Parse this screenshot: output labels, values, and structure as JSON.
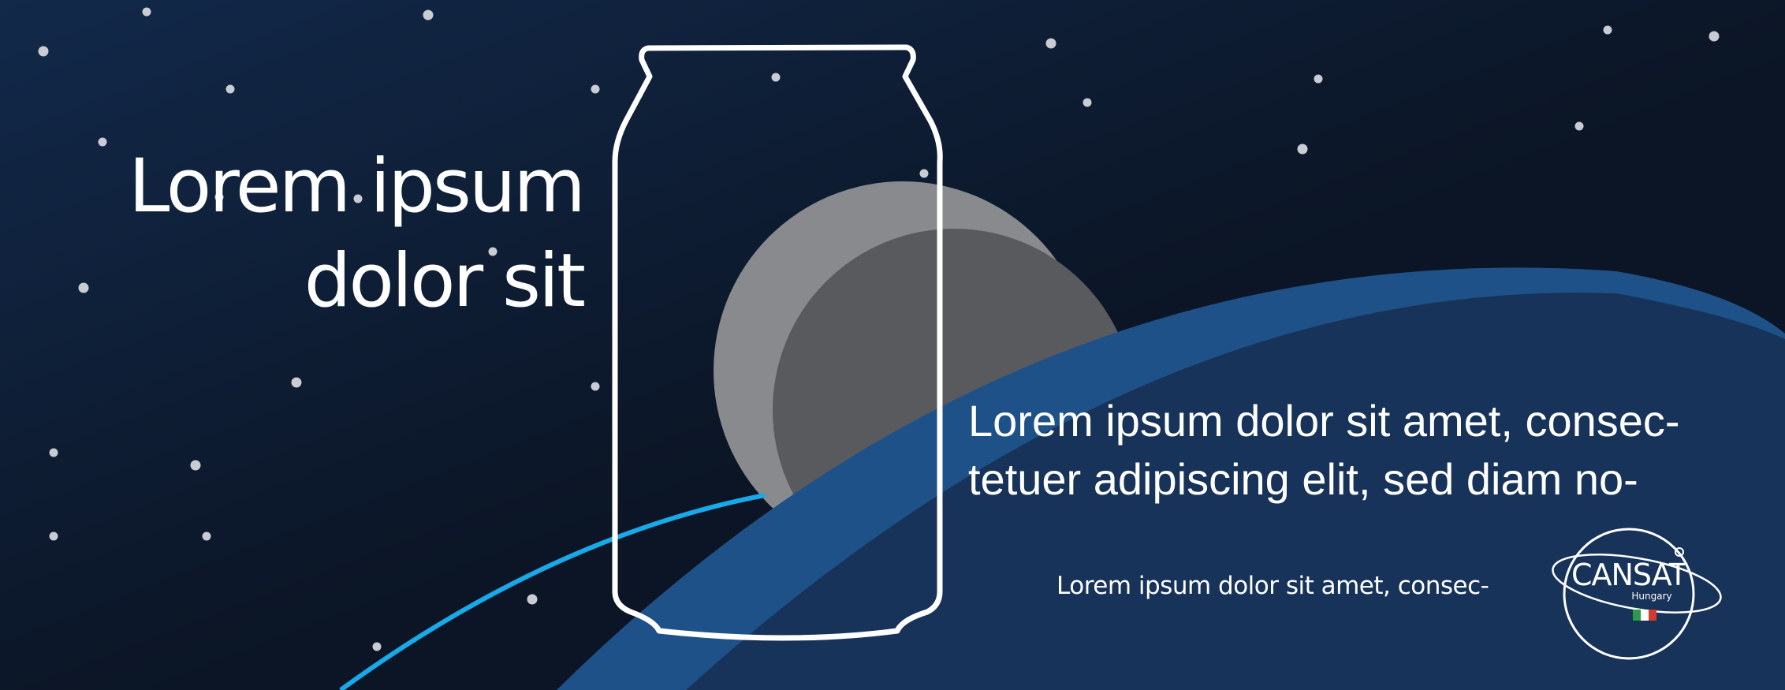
{
  "headline": {
    "line1": "Lorem ipsum",
    "line2": "dolor sit"
  },
  "body": {
    "line1": "Lorem ipsum dolor sit amet, consec-",
    "line2": "tetuer adipiscing elit, sed diam no-"
  },
  "tagline": "Lorem ipsum dolor sit amet, consec-",
  "logo": {
    "name": "CANSAT",
    "subtitle": "Hungary"
  },
  "colors": {
    "background_top": "#12294a",
    "background_bottom": "#0b1525",
    "planet_band": "#1f5189",
    "planet_body": "#17335a",
    "orbit_line": "#18a9e8",
    "moon_light": "#888a8e",
    "moon_dark": "#595a5e",
    "outline": "#ffffff",
    "star": "#c9ccd2",
    "flag_green": "#2c9a4a",
    "flag_red": "#d63a2f"
  },
  "icons": {
    "can": "can-outline-icon",
    "moon": "moon-icon",
    "logo": "cansat-logo-icon"
  }
}
